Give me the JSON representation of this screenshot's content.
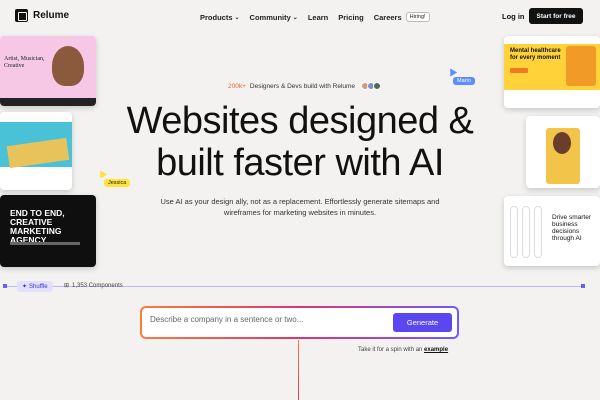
{
  "nav": {
    "logo": "Relume",
    "links": [
      {
        "label": "Products",
        "has_dropdown": true
      },
      {
        "label": "Community",
        "has_dropdown": true
      },
      {
        "label": "Learn"
      },
      {
        "label": "Pricing"
      },
      {
        "label": "Careers",
        "badge": "Hiring!"
      }
    ],
    "login": "Log in",
    "cta": "Start for free"
  },
  "hero": {
    "badge_highlight": "200k+",
    "badge_text": "Designers & Devs build with Relume",
    "title_line1": "Websites designed &",
    "title_line2": "built faster with AI",
    "subtitle": "Use AI as your design ally, not as a replacement. Effortlessly generate sitemaps and wireframes for marketing websites in minutes."
  },
  "toolbar": {
    "shuffle": "Shuffle",
    "components": "1,353 Components"
  },
  "prompt": {
    "placeholder": "Describe a company in a sentence or two...",
    "button": "Generate",
    "try_text": "Take it for a spin with an",
    "try_link": "example"
  },
  "cards": {
    "left_top": "Artist, Musician, Creative",
    "left_bottom": "END TO END, CREATIVE MARKETING AGENCY",
    "right_top": "Mental healthcare for every moment",
    "right_bottom": "Drive smarter business decisions through AI"
  },
  "cursors": {
    "mario": "Mario",
    "jessica": "Jessica"
  },
  "colors": {
    "accent": "#5b47f0",
    "highlight": "#e86a2c"
  }
}
